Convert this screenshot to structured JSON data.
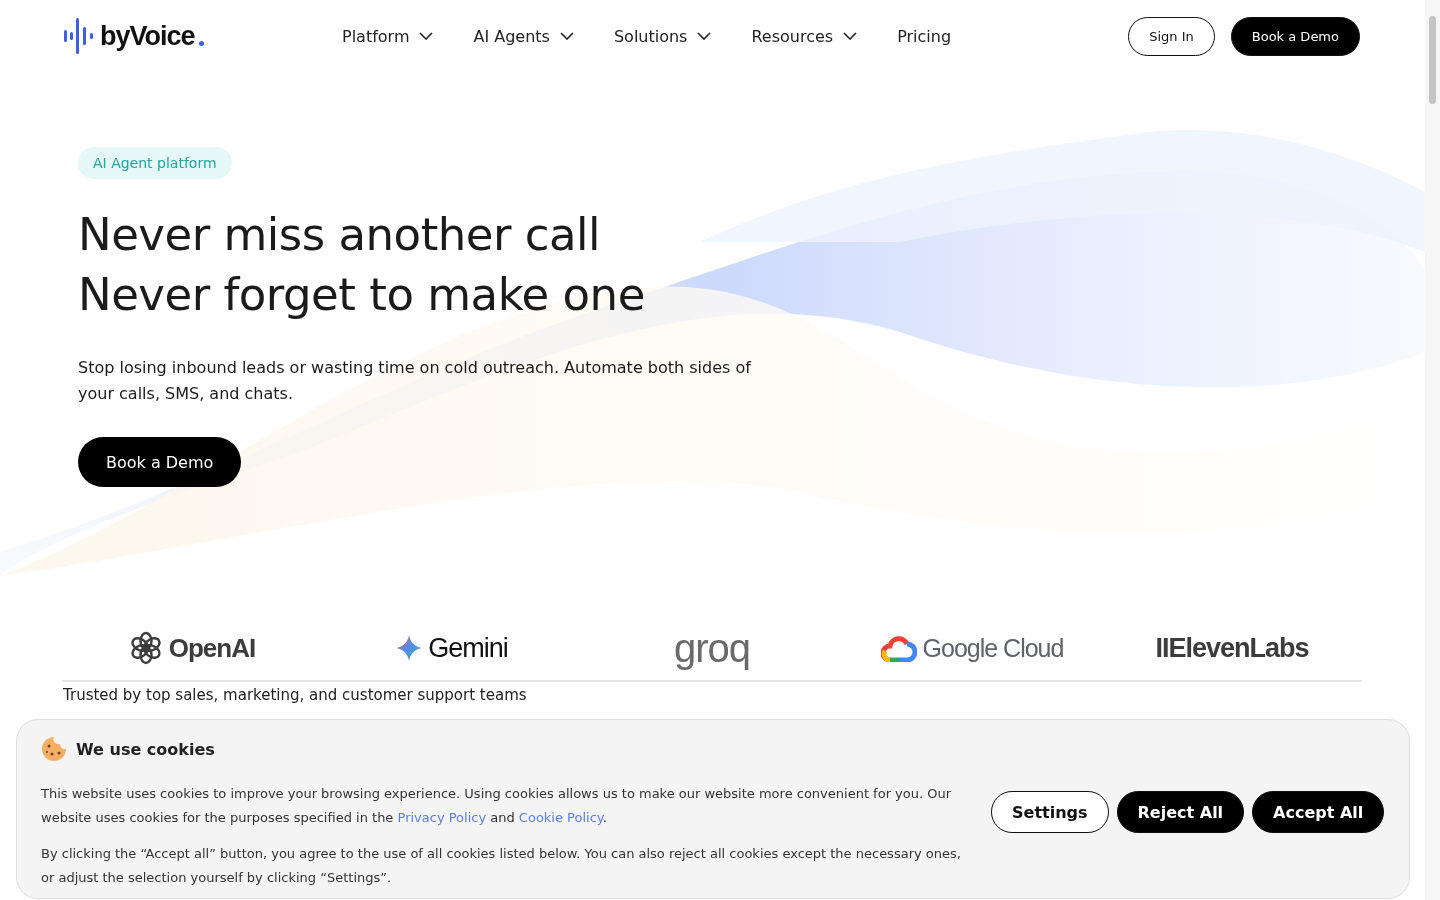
{
  "header": {
    "logo": "byVoice",
    "nav": [
      {
        "label": "Platform",
        "has_menu": true
      },
      {
        "label": "AI Agents",
        "has_menu": true
      },
      {
        "label": "Solutions",
        "has_menu": true
      },
      {
        "label": "Resources",
        "has_menu": true
      },
      {
        "label": "Pricing",
        "has_menu": false
      }
    ],
    "actions": [
      {
        "label": "Sign In",
        "kind": "outline"
      },
      {
        "label": "Book a Demo",
        "kind": "solid"
      }
    ]
  },
  "hero": {
    "badge": "AI Agent platform",
    "headline": [
      "Never miss another call",
      "Never forget to make one"
    ],
    "subtitle": "Stop losing inbound leads or wasting time on cold outreach. Automate both sides of your calls, SMS, and chats.",
    "button": "Book a Demo"
  },
  "partners": [
    {
      "name": "OpenAI",
      "kind": "openai"
    },
    {
      "name": "Gemini",
      "kind": "gemini"
    },
    {
      "name": "groq",
      "kind": "groq"
    },
    {
      "name": "Google Cloud",
      "kind": "gcloud"
    },
    {
      "name": "IIElevenLabs",
      "kind": "eleven"
    }
  ],
  "trusted": "Trusted by top sales, marketing, and customer support teams",
  "cookie_banner": {
    "title": "We use cookies",
    "paragraphs": [
      [
        {
          "kind": "text",
          "text": "This website uses cookies to improve your browsing experience. Using cookies allows us to make our website more convenient for you. Our website uses cookies for the purposes specified in the "
        },
        {
          "kind": "link",
          "text": "Privacy Policy"
        },
        {
          "kind": "text",
          "text": " and "
        },
        {
          "kind": "link",
          "text": "Cookie Policy"
        },
        {
          "kind": "text",
          "text": "."
        }
      ],
      [
        {
          "kind": "text",
          "text": "By clicking the “Accept all” button, you agree to the use of all cookies listed below. You can also reject all cookies except the necessary ones, or adjust the selection yourself by clicking “Settings”."
        }
      ]
    ],
    "buttons": [
      {
        "label": "Settings",
        "kind": "outline"
      },
      {
        "label": "Reject All",
        "kind": "solid"
      },
      {
        "label": "Accept All",
        "kind": "solid"
      }
    ]
  }
}
